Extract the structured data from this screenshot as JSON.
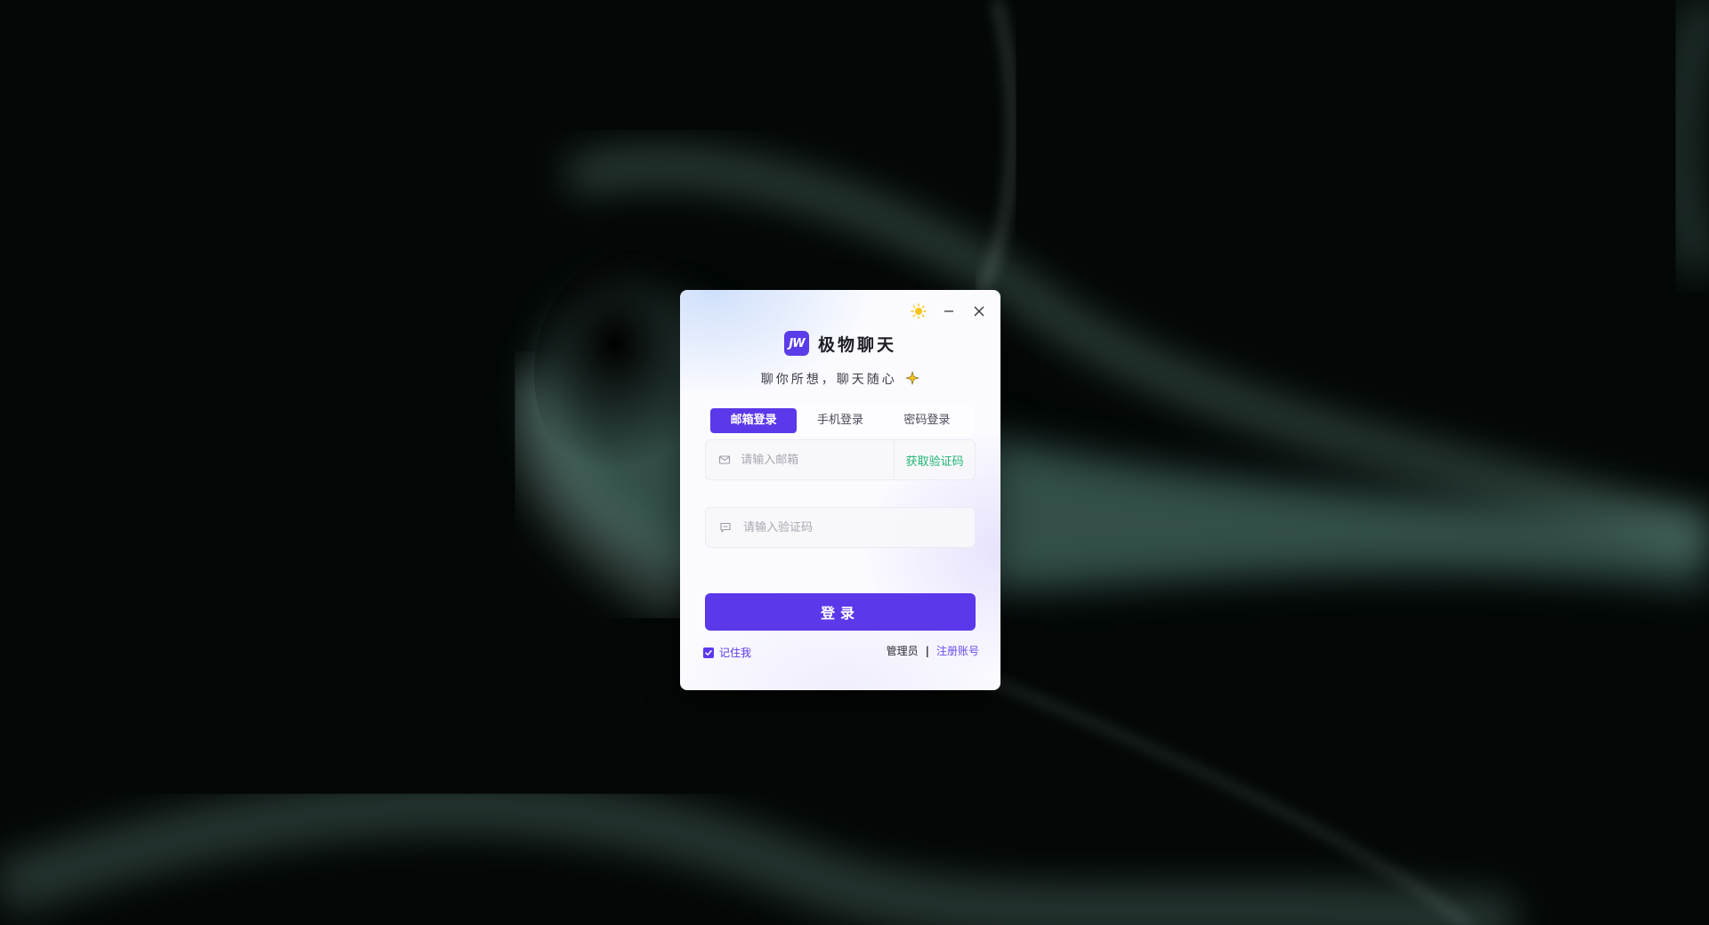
{
  "app": {
    "name": "极物聊天",
    "logo_text": "JW",
    "slogan": "聊你所想，聊天随心"
  },
  "icons": {
    "theme_toggle": "sun-icon",
    "minimize": "minimize-icon",
    "close": "close-icon",
    "email_field": "mail-icon",
    "code_field": "message-icon",
    "remember_check": "checkmark-icon"
  },
  "tabs": [
    {
      "label": "邮箱登录",
      "active": true
    },
    {
      "label": "手机登录",
      "active": false
    },
    {
      "label": "密码登录",
      "active": false
    }
  ],
  "email": {
    "placeholder": "请输入邮箱",
    "value": "",
    "send_code_label": "获取验证码"
  },
  "code": {
    "placeholder": "请输入验证码",
    "value": ""
  },
  "login_button": {
    "label": "登录"
  },
  "footer": {
    "remember_label": "记住我",
    "remember_checked": true,
    "admin_label": "管理员",
    "separator": "|",
    "register_label": "注册账号"
  },
  "colors": {
    "accent": "#5b38ea",
    "send_code": "#22b573",
    "sun": "#f5c518"
  }
}
